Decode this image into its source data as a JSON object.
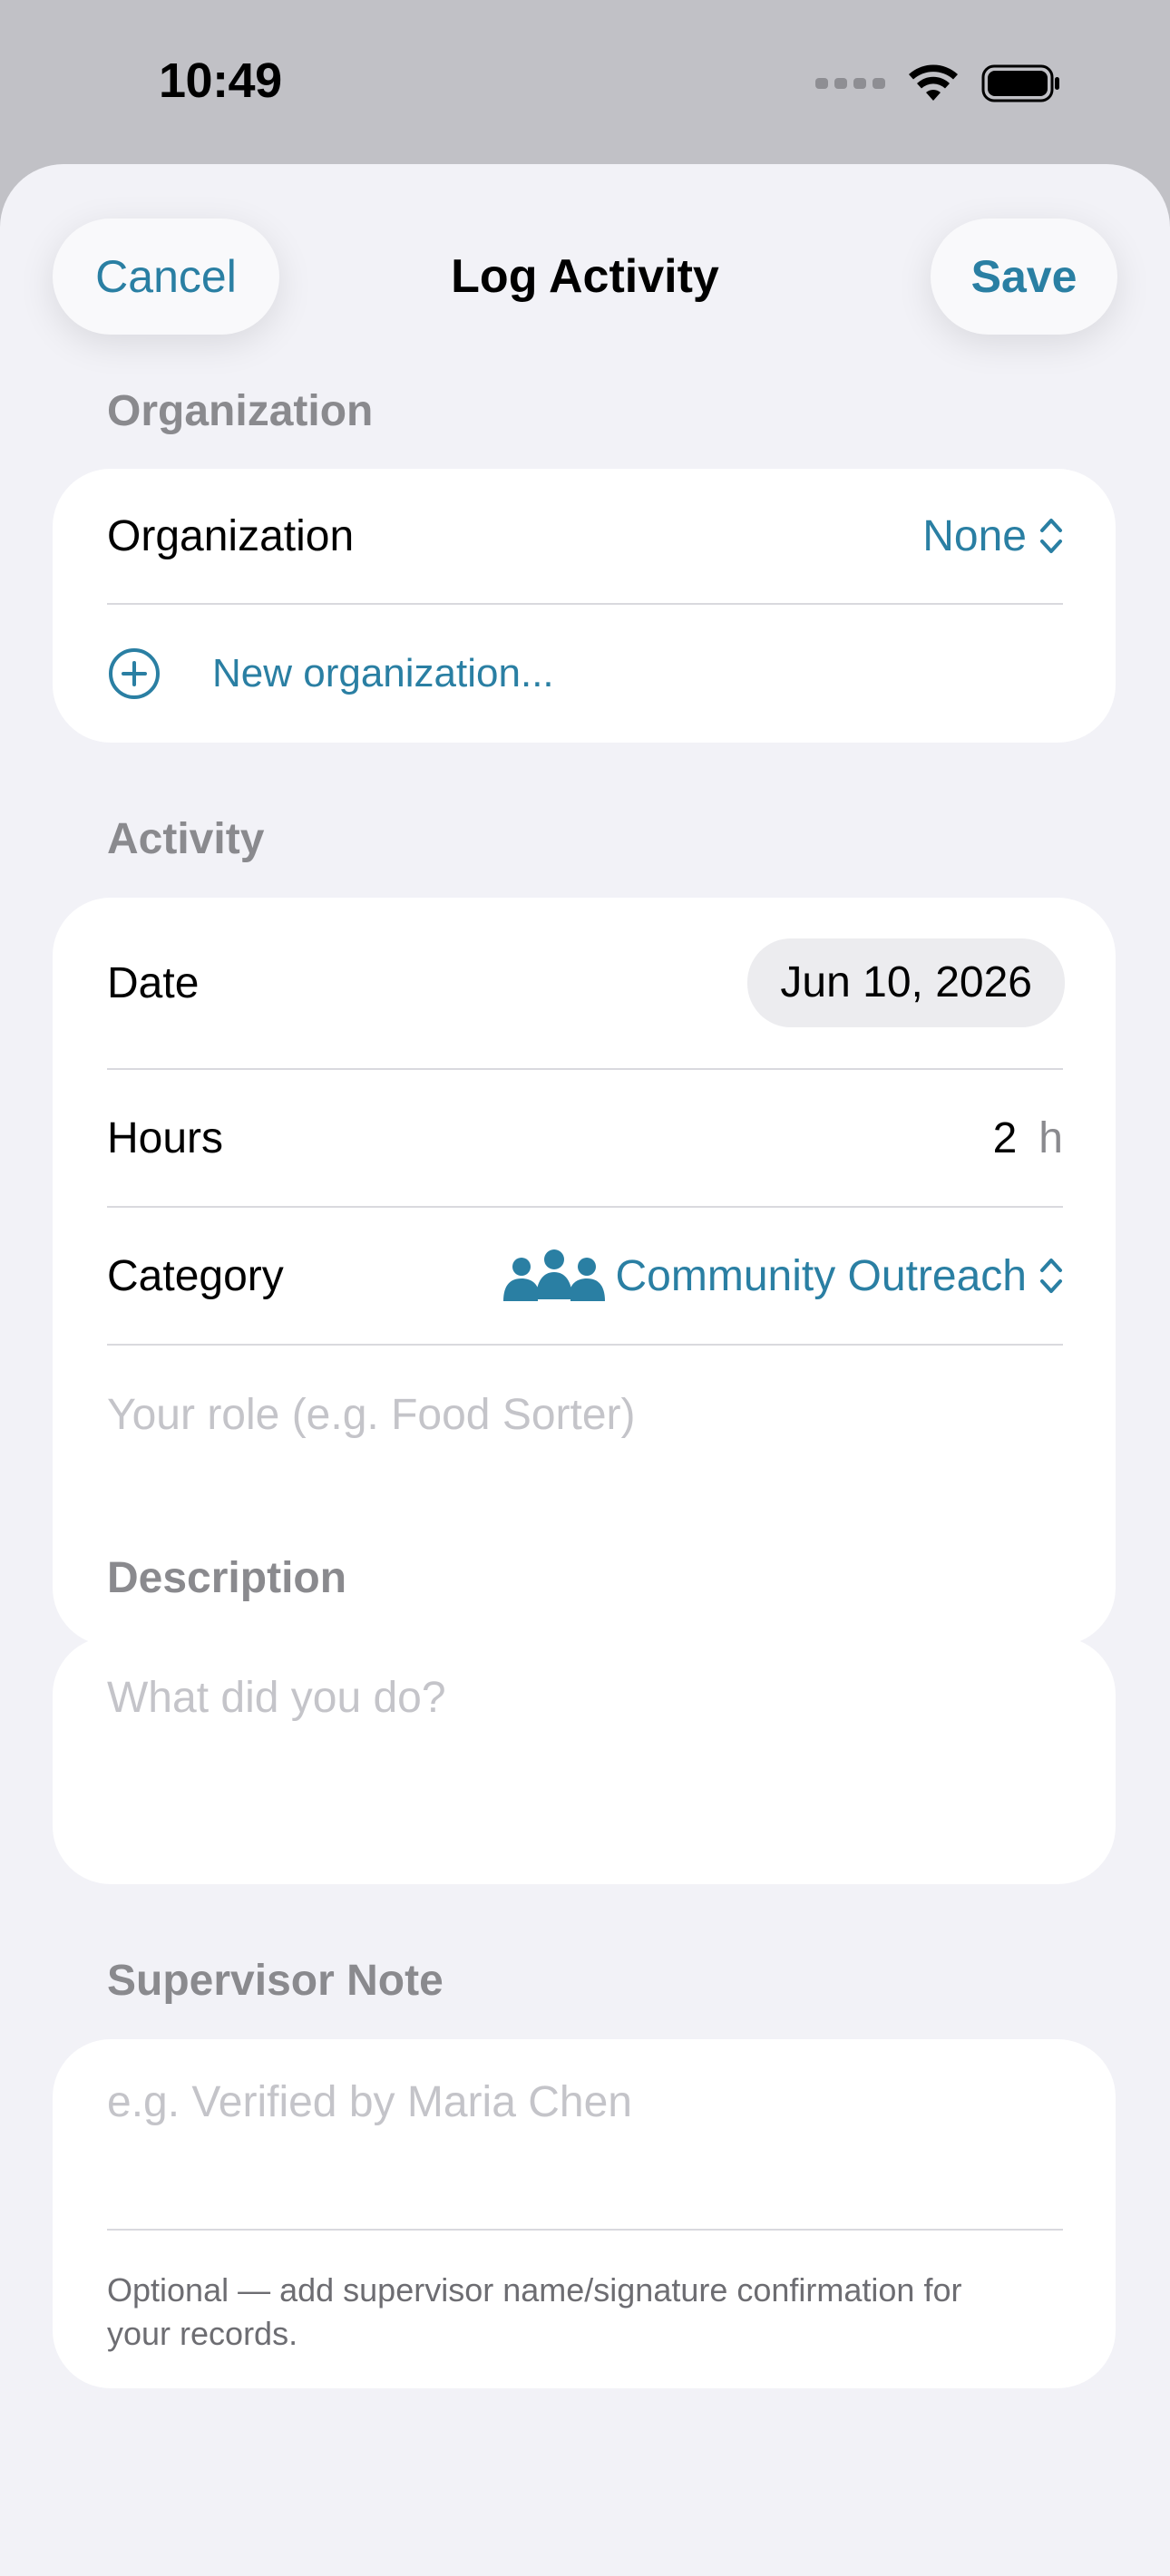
{
  "status_bar": {
    "time": "10:49"
  },
  "nav": {
    "cancel_label": "Cancel",
    "title": "Log Activity",
    "save_label": "Save"
  },
  "organization": {
    "header": "Organization",
    "label": "Organization",
    "value": "None",
    "new_label": "New organization..."
  },
  "activity": {
    "header": "Activity",
    "date_label": "Date",
    "date_value": "Jun 10, 2026",
    "hours_label": "Hours",
    "hours_value": "2",
    "hours_unit": "h",
    "category_label": "Category",
    "category_value": "Community Outreach",
    "category_icon": "people-icon",
    "role_placeholder": "Your role (e.g. Food Sorter)"
  },
  "description": {
    "header": "Description",
    "placeholder": "What did you do?"
  },
  "supervisor": {
    "header": "Supervisor Note",
    "placeholder": "e.g. Verified by Maria Chen",
    "footer": "Optional — add supervisor name/signature confirmation for your records."
  },
  "colors": {
    "accent": "#2a7fa3",
    "sheet_bg": "#f2f2f7",
    "card_bg": "#ffffff"
  }
}
